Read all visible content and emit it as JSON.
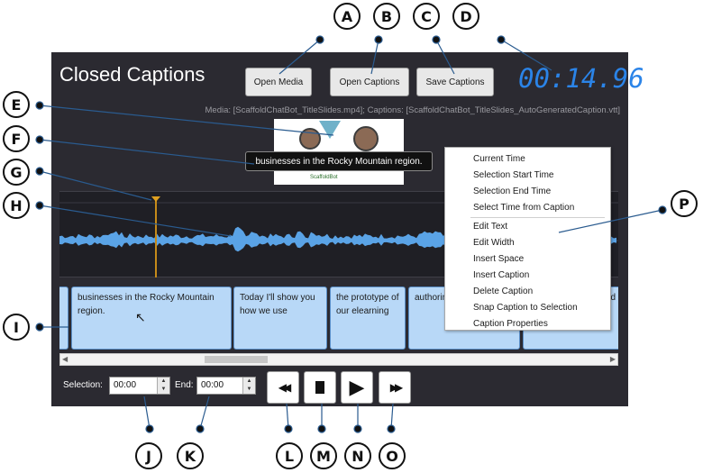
{
  "app": {
    "title": "Closed Captions",
    "buttons": {
      "open_media": "Open Media",
      "open_captions": "Open Captions",
      "save_captions": "Save Captions"
    },
    "timecode": "00:14.96",
    "media_line": "Media: [ScaffoldChatBot_TitleSlides.mp4]; Captions: [ScaffoldChatBot_TitleSlides_AutoGeneratedCaption.vtt]"
  },
  "video": {
    "caption_overlay": "businesses in the Rocky Mountain region.",
    "thumb_text": "ScaffoldBot"
  },
  "captions": [
    {
      "text": ""
    },
    {
      "text": "businesses in the Rocky Mountain region."
    },
    {
      "text": "Today I'll show you how we use"
    },
    {
      "text": "the prototype of our elearning"
    },
    {
      "text": "authoring tool to design"
    },
    {
      "text": "d"
    }
  ],
  "selection": {
    "label": "Selection:",
    "value": "00:00",
    "end_label": "End:",
    "end_value": "00:00"
  },
  "transport": {
    "rewind_icon": "rewind-icon",
    "stop_icon": "stop-icon",
    "play_icon": "play-icon",
    "forward_icon": "fast-forward-icon"
  },
  "context_menu": {
    "group1": [
      "Current Time",
      "Selection Start Time",
      "Selection End Time",
      "Select Time from Caption"
    ],
    "group2": [
      "Edit Text",
      "Edit Width",
      "Insert Space",
      "Insert Caption",
      "Delete Caption",
      "Snap Caption to Selection",
      "Caption Properties"
    ]
  },
  "callouts": [
    "A",
    "B",
    "C",
    "D",
    "E",
    "F",
    "G",
    "H",
    "I",
    "J",
    "K",
    "L",
    "M",
    "N",
    "O",
    "P"
  ],
  "colors": {
    "panel": "#2b2a31",
    "timecode": "#2b84e8",
    "waveform": "#5aa3e6",
    "caption_block": "#b8d8f7",
    "playhead": "#c58a1a",
    "callout_line": "#2a5b8f"
  }
}
